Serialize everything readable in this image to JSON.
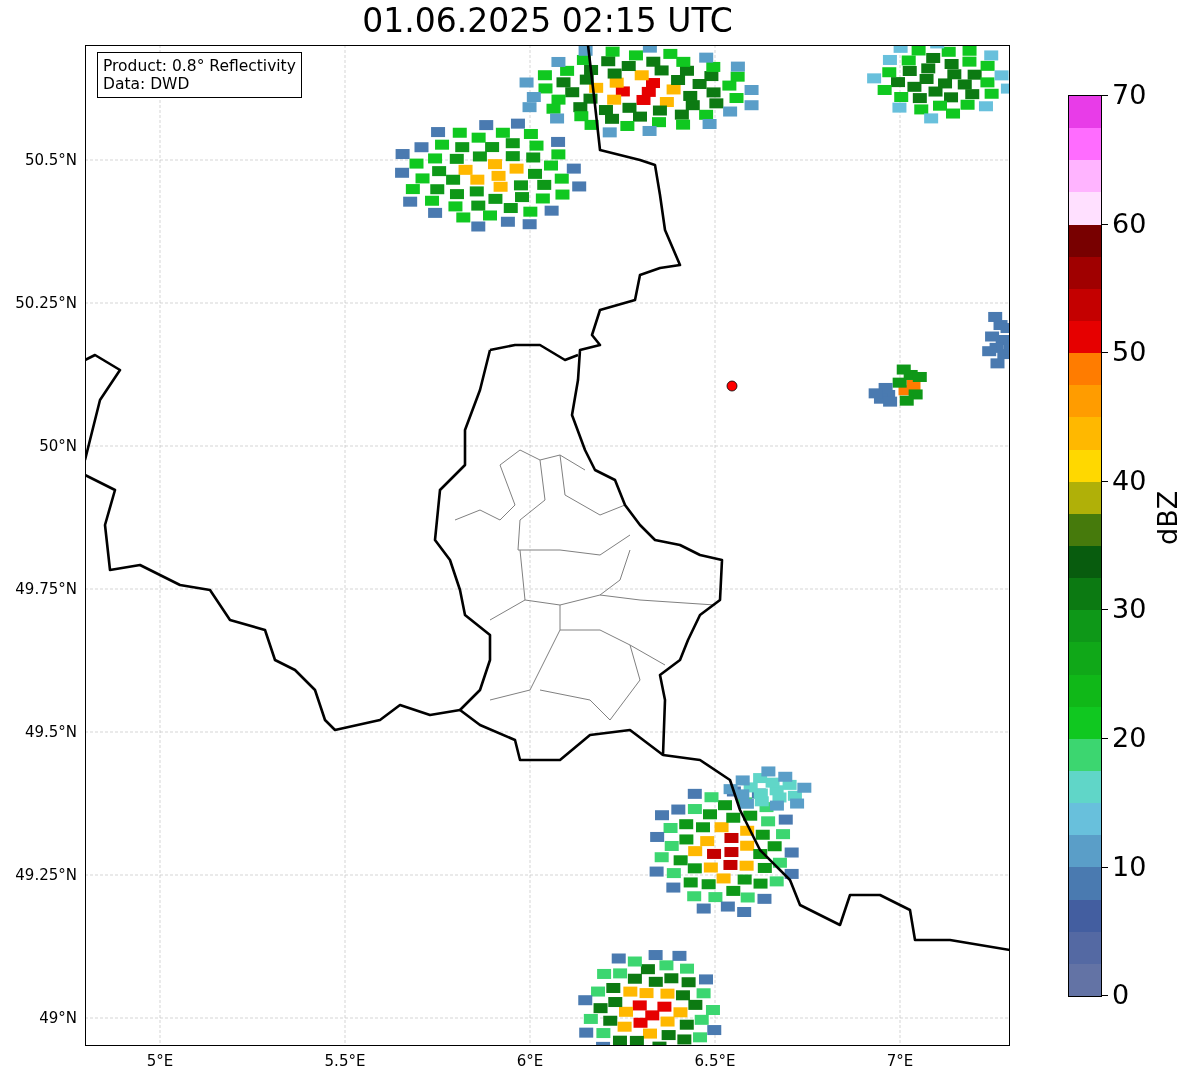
{
  "title": "01.06.2025 02:15 UTC",
  "info_box": [
    "Product: 0.8° Reflectivity",
    "Data: DWD"
  ],
  "y_ticks": [
    "50.5°N",
    "50.25°N",
    "50°N",
    "49.75°N",
    "49.5°N",
    "49.25°N",
    "49°N"
  ],
  "x_ticks": [
    "5°E",
    "5.5°E",
    "6°E",
    "6.5°E",
    "7°E"
  ],
  "colorbar": {
    "label": "dBZ",
    "ticks": [
      "70",
      "60",
      "50",
      "40",
      "30",
      "20",
      "10",
      "0"
    ],
    "bins": [
      {
        "color": "#6373a5"
      },
      {
        "color": "#5469a3"
      },
      {
        "color": "#435ea0"
      },
      {
        "color": "#4a7ab0"
      },
      {
        "color": "#5a9ec8"
      },
      {
        "color": "#68c0dc"
      },
      {
        "color": "#60d6c8"
      },
      {
        "color": "#3cd670"
      },
      {
        "color": "#10c820"
      },
      {
        "color": "#10b818"
      },
      {
        "color": "#10a818"
      },
      {
        "color": "#0e9818"
      },
      {
        "color": "#0c7a12"
      },
      {
        "color": "#085c0e"
      },
      {
        "color": "#467a0c"
      },
      {
        "color": "#b0b008"
      },
      {
        "color": "#ffd800"
      },
      {
        "color": "#ffb800"
      },
      {
        "color": "#ff9c00"
      },
      {
        "color": "#ff7c00"
      },
      {
        "color": "#e60000"
      },
      {
        "color": "#c40000"
      },
      {
        "color": "#a00000"
      },
      {
        "color": "#780000"
      },
      {
        "color": "#ffe0ff"
      },
      {
        "color": "#ffb4ff"
      },
      {
        "color": "#ff6cff"
      },
      {
        "color": "#e83ce8"
      }
    ]
  }
}
